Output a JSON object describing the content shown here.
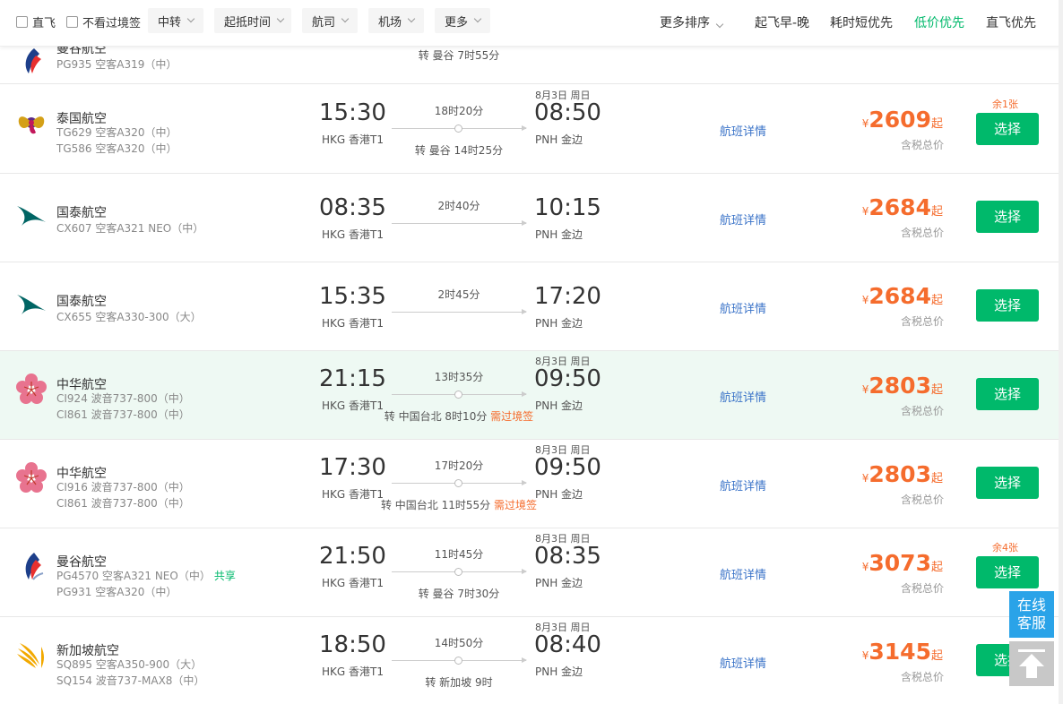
{
  "filters": {
    "nonstop": "直飞",
    "no_transit_visa": "不看过境签",
    "dropdowns": [
      "中转",
      "起抵时间",
      "航司",
      "机场",
      "更多"
    ]
  },
  "sort": {
    "more": "更多排序",
    "options": [
      "起飞早-晚",
      "耗时短优先",
      "低价优先",
      "直飞优先"
    ],
    "active_index": 2,
    "active_color": "#00b96b"
  },
  "partial_row": {
    "airline": "曼谷航空",
    "flight1": "PG935 空客A319（中）",
    "transfer": "转 曼谷 7时55分"
  },
  "flights": [
    {
      "airline": "泰国航空",
      "flight1": "TG629 空客A320（中）",
      "share": "",
      "flight2": "TG586 空客A320（中）",
      "dep_time": "15:30",
      "dep_airport": "HKG 香港T1",
      "duration": "18时20分",
      "arr_date": "8月3日 周日",
      "arr_time": "08:50",
      "arr_airport": "PNH 金边",
      "transfer": "转 曼谷 14时25分",
      "visa": "",
      "detail": "航班详情",
      "currency": "¥",
      "price": "2609",
      "qi": "起",
      "tax": "含税总价",
      "remaining": "余1张",
      "select": "选择",
      "logo": "thai-logo"
    },
    {
      "airline": "国泰航空",
      "flight1": "CX607 空客A321 NEO（中）",
      "share": "",
      "flight2": "",
      "dep_time": "08:35",
      "dep_airport": "HKG 香港T1",
      "duration": "2时40分",
      "arr_date": "",
      "arr_time": "10:15",
      "arr_airport": "PNH 金边",
      "transfer": "",
      "visa": "",
      "detail": "航班详情",
      "currency": "¥",
      "price": "2684",
      "qi": "起",
      "tax": "含税总价",
      "remaining": "",
      "select": "选择",
      "logo": "cathay-logo"
    },
    {
      "airline": "国泰航空",
      "flight1": "CX655 空客A330-300（大）",
      "share": "",
      "flight2": "",
      "dep_time": "15:35",
      "dep_airport": "HKG 香港T1",
      "duration": "2时45分",
      "arr_date": "",
      "arr_time": "17:20",
      "arr_airport": "PNH 金边",
      "transfer": "",
      "visa": "",
      "detail": "航班详情",
      "currency": "¥",
      "price": "2684",
      "qi": "起",
      "tax": "含税总价",
      "remaining": "",
      "select": "选择",
      "logo": "cathay-logo"
    },
    {
      "airline": "中华航空",
      "flight1": "CI924 波音737-800（中）",
      "share": "",
      "flight2": "CI861 波音737-800（中）",
      "dep_time": "21:15",
      "dep_airport": "HKG 香港T1",
      "duration": "13时35分",
      "arr_date": "8月3日 周日",
      "arr_time": "09:50",
      "arr_airport": "PNH 金边",
      "transfer": "转 中国台北 8时10分",
      "visa": "需过境签",
      "detail": "航班详情",
      "currency": "¥",
      "price": "2803",
      "qi": "起",
      "tax": "含税总价",
      "remaining": "",
      "select": "选择",
      "logo": "china-airlines-logo"
    },
    {
      "airline": "中华航空",
      "flight1": "CI916 波音737-800（中）",
      "share": "",
      "flight2": "CI861 波音737-800（中）",
      "dep_time": "17:30",
      "dep_airport": "HKG 香港T1",
      "duration": "17时20分",
      "arr_date": "8月3日 周日",
      "arr_time": "09:50",
      "arr_airport": "PNH 金边",
      "transfer": "转 中国台北 11时55分",
      "visa": "需过境签",
      "detail": "航班详情",
      "currency": "¥",
      "price": "2803",
      "qi": "起",
      "tax": "含税总价",
      "remaining": "",
      "select": "选择",
      "logo": "china-airlines-logo"
    },
    {
      "airline": "曼谷航空",
      "flight1": "PG4570 空客A321 NEO（中）",
      "share": "共享",
      "flight2": "PG931 空客A320（中）",
      "dep_time": "21:50",
      "dep_airport": "HKG 香港T1",
      "duration": "11时45分",
      "arr_date": "8月3日 周日",
      "arr_time": "08:35",
      "arr_airport": "PNH 金边",
      "transfer": "转 曼谷 7时30分",
      "visa": "",
      "detail": "航班详情",
      "currency": "¥",
      "price": "3073",
      "qi": "起",
      "tax": "含税总价",
      "remaining": "余4张",
      "select": "选择",
      "logo": "bangkok-airways-logo"
    },
    {
      "airline": "新加坡航空",
      "flight1": "SQ895 空客A350-900（大）",
      "share": "",
      "flight2": "SQ154 波音737-MAX8（中）",
      "dep_time": "18:50",
      "dep_airport": "HKG 香港T1",
      "duration": "14时50分",
      "arr_date": "8月3日 周日",
      "arr_time": "08:40",
      "arr_airport": "PNH 金边",
      "transfer": "转 新加坡 9时",
      "visa": "",
      "detail": "航班详情",
      "currency": "¥",
      "price": "3145",
      "qi": "起",
      "tax": "含税总价",
      "remaining": "",
      "select": "选择",
      "logo": "singapore-airlines-logo"
    }
  ],
  "side": {
    "chat_line1": "在线",
    "chat_line2": "客服",
    "top_icon": "arrow-up-icon"
  },
  "colors": {
    "accent_green": "#00b96b",
    "price_orange": "#f56c2d",
    "link_blue": "#3a73c8"
  }
}
